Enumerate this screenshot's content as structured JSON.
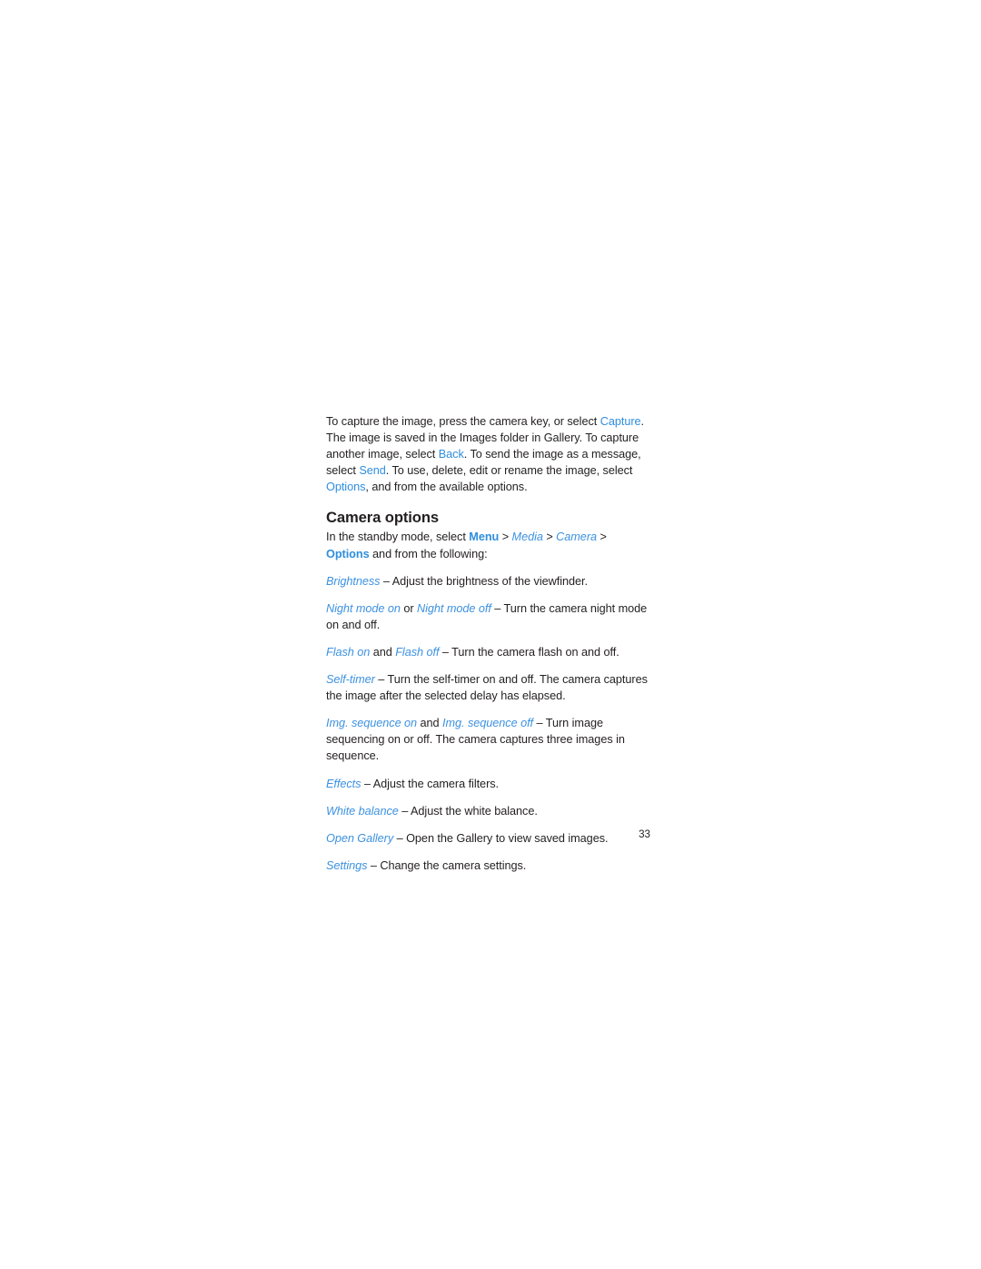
{
  "document": {
    "page_number": "33",
    "colors": {
      "text": "#231f20",
      "link_blue": "#2f8ede",
      "term_blue": "#3d92e0",
      "background": "#ffffff"
    }
  },
  "intro": {
    "s1": "To capture the image, press the camera key, or select ",
    "capture": "Capture",
    "s2": ". The image is saved in the Images folder in Gallery. To capture another image, select ",
    "back": "Back",
    "s3": ". To send the image as a message, select ",
    "send": "Send",
    "s4": ". To use, delete, edit or rename the image, select ",
    "options": "Options",
    "s5": ", and from the available options."
  },
  "section": {
    "heading": "Camera options",
    "path_lead": "In the standby mode, select ",
    "path_menu": "Menu",
    "path_sep1": " > ",
    "path_media": "Media",
    "path_sep2": " > ",
    "path_camera": "Camera",
    "path_sep3": " > ",
    "path_options": "Options",
    "path_tail": " and from the following:"
  },
  "options": [
    {
      "terms": [
        "Brightness"
      ],
      "joiners": [],
      "description": " – Adjust the brightness of the viewfinder."
    },
    {
      "terms": [
        "Night mode on",
        "Night mode off"
      ],
      "joiners": [
        " or "
      ],
      "description": " – Turn the camera night mode on and off."
    },
    {
      "terms": [
        "Flash on",
        "Flash off"
      ],
      "joiners": [
        " and "
      ],
      "description": " – Turn the camera flash on and off."
    },
    {
      "terms": [
        "Self-timer"
      ],
      "joiners": [],
      "description": " – Turn the self-timer on and off. The camera captures the image after the selected delay has elapsed."
    },
    {
      "terms": [
        "Img. sequence on",
        "Img. sequence off"
      ],
      "joiners": [
        " and "
      ],
      "description": " – Turn image sequencing on or off. The camera captures three images in sequence."
    },
    {
      "terms": [
        "Effects"
      ],
      "joiners": [],
      "description": " – Adjust the camera filters."
    },
    {
      "terms": [
        "White balance"
      ],
      "joiners": [],
      "description": " – Adjust the white balance."
    },
    {
      "terms": [
        "Open Gallery"
      ],
      "joiners": [],
      "description": " – Open the Gallery to view saved images."
    },
    {
      "terms": [
        "Settings"
      ],
      "joiners": [],
      "description": " – Change the camera settings."
    }
  ]
}
